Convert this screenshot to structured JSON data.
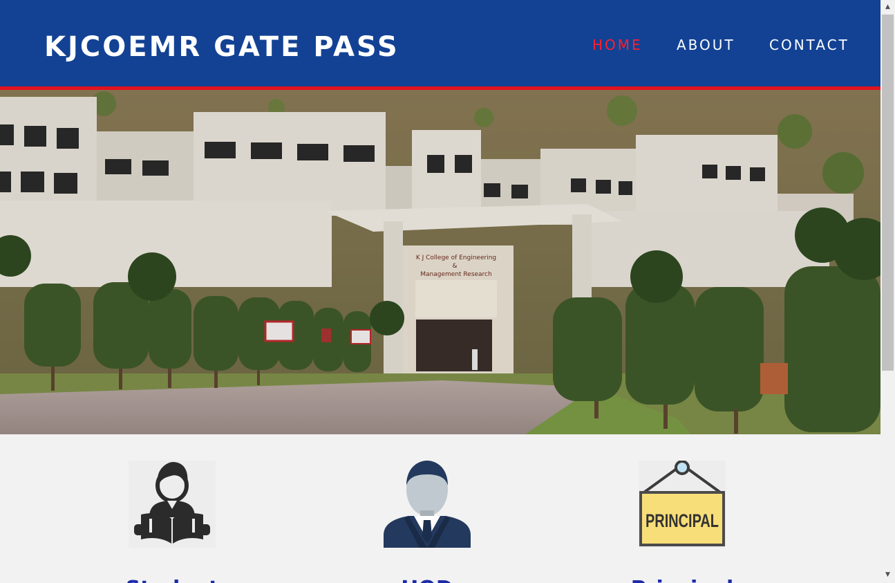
{
  "header": {
    "brand": "KJCOEMR GATE PASS",
    "nav": {
      "home": "HOME",
      "about": "ABOUT",
      "contact": "CONTACT"
    }
  },
  "hero": {
    "signage_line1": "K J College of Engineering",
    "signage_line2": "&",
    "signage_line3": "Management Research"
  },
  "cards": [
    {
      "title": "Student",
      "icon": "student-reading-icon"
    },
    {
      "title": "HOD",
      "icon": "person-suit-icon"
    },
    {
      "title": "Principal",
      "icon": "principal-sign-icon"
    }
  ],
  "principal_sign_text": "PRINCIPAL",
  "colors": {
    "navbar": "#134294",
    "accent_red": "#e3121f",
    "active_link": "#ff1f2e",
    "card_title": "#1d2ba8",
    "page_bg": "#f2f2f2"
  }
}
